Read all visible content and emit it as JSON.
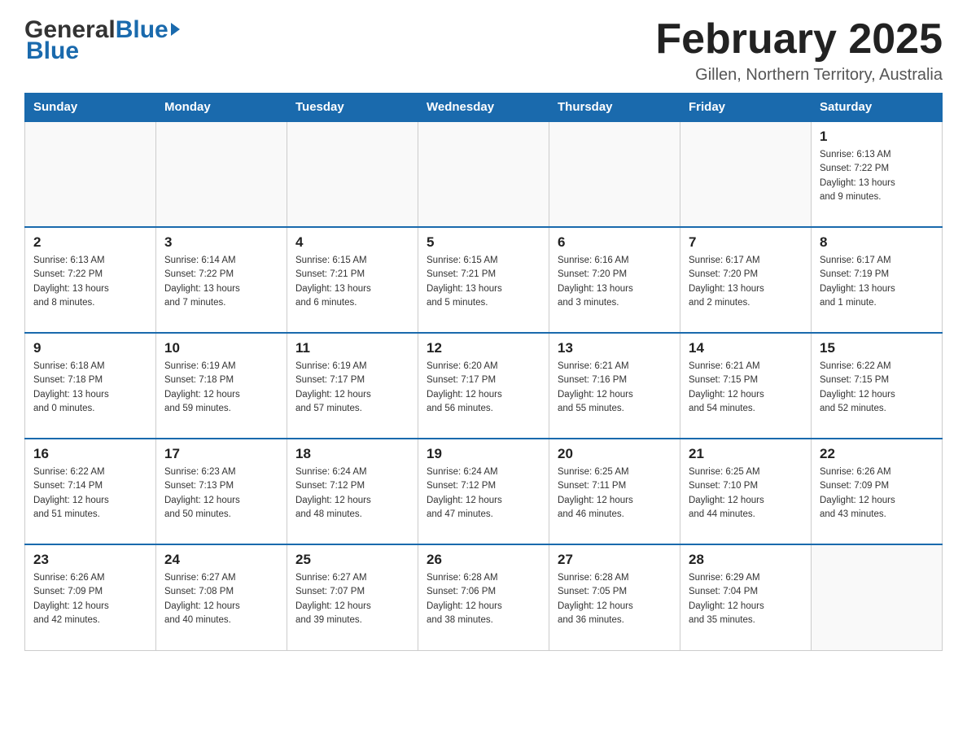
{
  "header": {
    "logo_general": "General",
    "logo_blue": "Blue",
    "month_title": "February 2025",
    "location": "Gillen, Northern Territory, Australia"
  },
  "weekdays": [
    "Sunday",
    "Monday",
    "Tuesday",
    "Wednesday",
    "Thursday",
    "Friday",
    "Saturday"
  ],
  "weeks": [
    [
      {
        "day": "",
        "info": ""
      },
      {
        "day": "",
        "info": ""
      },
      {
        "day": "",
        "info": ""
      },
      {
        "day": "",
        "info": ""
      },
      {
        "day": "",
        "info": ""
      },
      {
        "day": "",
        "info": ""
      },
      {
        "day": "1",
        "info": "Sunrise: 6:13 AM\nSunset: 7:22 PM\nDaylight: 13 hours\nand 9 minutes."
      }
    ],
    [
      {
        "day": "2",
        "info": "Sunrise: 6:13 AM\nSunset: 7:22 PM\nDaylight: 13 hours\nand 8 minutes."
      },
      {
        "day": "3",
        "info": "Sunrise: 6:14 AM\nSunset: 7:22 PM\nDaylight: 13 hours\nand 7 minutes."
      },
      {
        "day": "4",
        "info": "Sunrise: 6:15 AM\nSunset: 7:21 PM\nDaylight: 13 hours\nand 6 minutes."
      },
      {
        "day": "5",
        "info": "Sunrise: 6:15 AM\nSunset: 7:21 PM\nDaylight: 13 hours\nand 5 minutes."
      },
      {
        "day": "6",
        "info": "Sunrise: 6:16 AM\nSunset: 7:20 PM\nDaylight: 13 hours\nand 3 minutes."
      },
      {
        "day": "7",
        "info": "Sunrise: 6:17 AM\nSunset: 7:20 PM\nDaylight: 13 hours\nand 2 minutes."
      },
      {
        "day": "8",
        "info": "Sunrise: 6:17 AM\nSunset: 7:19 PM\nDaylight: 13 hours\nand 1 minute."
      }
    ],
    [
      {
        "day": "9",
        "info": "Sunrise: 6:18 AM\nSunset: 7:18 PM\nDaylight: 13 hours\nand 0 minutes."
      },
      {
        "day": "10",
        "info": "Sunrise: 6:19 AM\nSunset: 7:18 PM\nDaylight: 12 hours\nand 59 minutes."
      },
      {
        "day": "11",
        "info": "Sunrise: 6:19 AM\nSunset: 7:17 PM\nDaylight: 12 hours\nand 57 minutes."
      },
      {
        "day": "12",
        "info": "Sunrise: 6:20 AM\nSunset: 7:17 PM\nDaylight: 12 hours\nand 56 minutes."
      },
      {
        "day": "13",
        "info": "Sunrise: 6:21 AM\nSunset: 7:16 PM\nDaylight: 12 hours\nand 55 minutes."
      },
      {
        "day": "14",
        "info": "Sunrise: 6:21 AM\nSunset: 7:15 PM\nDaylight: 12 hours\nand 54 minutes."
      },
      {
        "day": "15",
        "info": "Sunrise: 6:22 AM\nSunset: 7:15 PM\nDaylight: 12 hours\nand 52 minutes."
      }
    ],
    [
      {
        "day": "16",
        "info": "Sunrise: 6:22 AM\nSunset: 7:14 PM\nDaylight: 12 hours\nand 51 minutes."
      },
      {
        "day": "17",
        "info": "Sunrise: 6:23 AM\nSunset: 7:13 PM\nDaylight: 12 hours\nand 50 minutes."
      },
      {
        "day": "18",
        "info": "Sunrise: 6:24 AM\nSunset: 7:12 PM\nDaylight: 12 hours\nand 48 minutes."
      },
      {
        "day": "19",
        "info": "Sunrise: 6:24 AM\nSunset: 7:12 PM\nDaylight: 12 hours\nand 47 minutes."
      },
      {
        "day": "20",
        "info": "Sunrise: 6:25 AM\nSunset: 7:11 PM\nDaylight: 12 hours\nand 46 minutes."
      },
      {
        "day": "21",
        "info": "Sunrise: 6:25 AM\nSunset: 7:10 PM\nDaylight: 12 hours\nand 44 minutes."
      },
      {
        "day": "22",
        "info": "Sunrise: 6:26 AM\nSunset: 7:09 PM\nDaylight: 12 hours\nand 43 minutes."
      }
    ],
    [
      {
        "day": "23",
        "info": "Sunrise: 6:26 AM\nSunset: 7:09 PM\nDaylight: 12 hours\nand 42 minutes."
      },
      {
        "day": "24",
        "info": "Sunrise: 6:27 AM\nSunset: 7:08 PM\nDaylight: 12 hours\nand 40 minutes."
      },
      {
        "day": "25",
        "info": "Sunrise: 6:27 AM\nSunset: 7:07 PM\nDaylight: 12 hours\nand 39 minutes."
      },
      {
        "day": "26",
        "info": "Sunrise: 6:28 AM\nSunset: 7:06 PM\nDaylight: 12 hours\nand 38 minutes."
      },
      {
        "day": "27",
        "info": "Sunrise: 6:28 AM\nSunset: 7:05 PM\nDaylight: 12 hours\nand 36 minutes."
      },
      {
        "day": "28",
        "info": "Sunrise: 6:29 AM\nSunset: 7:04 PM\nDaylight: 12 hours\nand 35 minutes."
      },
      {
        "day": "",
        "info": ""
      }
    ]
  ]
}
